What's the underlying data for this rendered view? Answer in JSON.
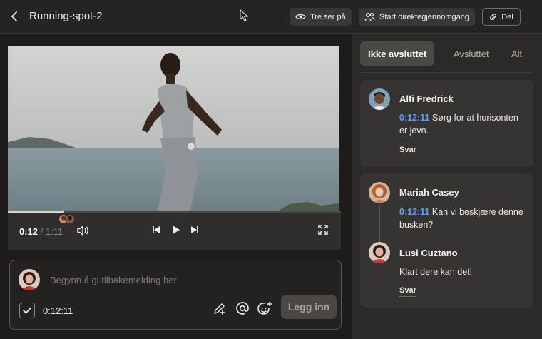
{
  "header": {
    "back_icon": "chevron-left-icon",
    "title": "Running-spot-2",
    "viewers_label": "Tre ser på",
    "walkthrough_label": "Start direktegjennomgang",
    "share_label": "Del"
  },
  "player": {
    "current_time": "0:12",
    "separator": "/",
    "total_time": "1:11",
    "progress": 0.17,
    "icons": [
      "volume-icon",
      "step-back-icon",
      "play-icon",
      "step-forward-icon",
      "fullscreen-icon"
    ]
  },
  "composer": {
    "placeholder": "Begynn å gi tilbakemelding her",
    "timestamp": "0:12:11",
    "timestamp_checked": true,
    "post_label": "Legg inn"
  },
  "comments_panel": {
    "tabs": [
      {
        "label": "Ikke avsluttet",
        "active": true
      },
      {
        "label": "Avsluttet",
        "active": false
      },
      {
        "label": "Alt",
        "active": false
      }
    ],
    "threads": [
      {
        "author": "Alfi Fredrick",
        "time": "0:12:11",
        "text_line1": "Sørg for at horisonten",
        "text_line2": "er jevn.",
        "reply_label": "Svar"
      },
      {
        "author": "Mariah Casey",
        "time": "0:12:11",
        "text_line1": "Kan vi beskjære denne",
        "text_line2": "busken?",
        "reply_author": "Lusi Cuztano",
        "reply_text": "Klart dere kan det!",
        "reply_label": "Svar"
      }
    ]
  },
  "colors": {
    "accent_time": "#5aa0f5",
    "panel_bg": "#2b2a29",
    "card_bg": "#363432"
  }
}
